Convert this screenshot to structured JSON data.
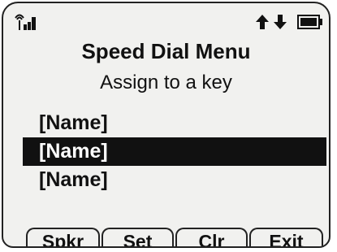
{
  "header": {
    "title": "Speed Dial Menu",
    "subtitle": "Assign to a key"
  },
  "status_bar": {
    "signal_icon": "signal-strength-icon",
    "data_icon": "up-down-arrows-icon",
    "battery_icon": "battery-icon"
  },
  "list": {
    "items": [
      {
        "label": "[Name]",
        "selected": false
      },
      {
        "label": "[Name]",
        "selected": true
      },
      {
        "label": "[Name]",
        "selected": false
      }
    ]
  },
  "softkeys": [
    {
      "label": "Spkr"
    },
    {
      "label": "Set"
    },
    {
      "label": "Clr"
    },
    {
      "label": "Exit"
    }
  ],
  "colors": {
    "background": "#f1f1ef",
    "highlight": "#111111",
    "text": "#111111"
  }
}
